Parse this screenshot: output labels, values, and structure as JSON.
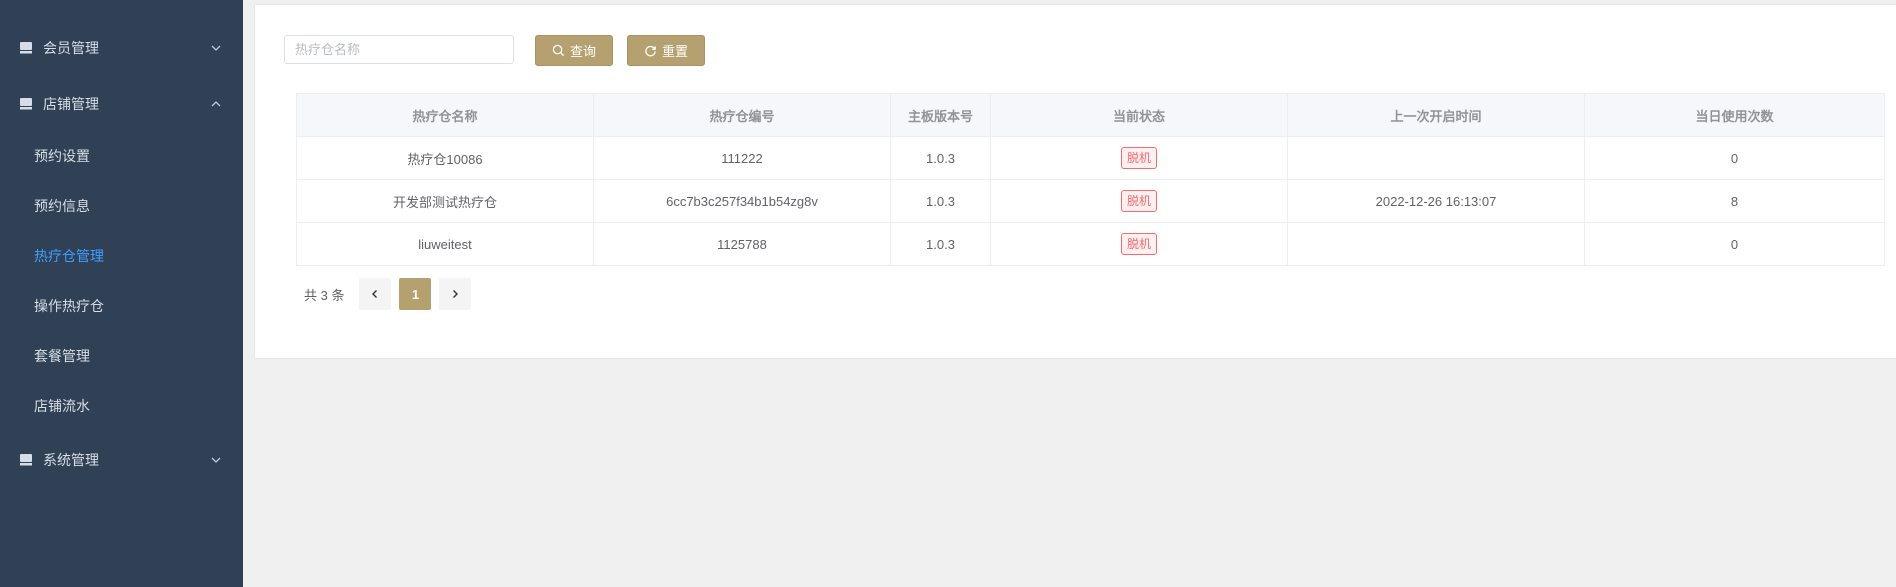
{
  "sidebar": {
    "groups": [
      {
        "label": "会员管理",
        "expanded": false
      },
      {
        "label": "店铺管理",
        "expanded": true
      },
      {
        "label": "系统管理",
        "expanded": false
      }
    ],
    "submenu": [
      {
        "label": "预约设置",
        "active": false
      },
      {
        "label": "预约信息",
        "active": false
      },
      {
        "label": "热疗仓管理",
        "active": true
      },
      {
        "label": "操作热疗仓",
        "active": false
      },
      {
        "label": "套餐管理",
        "active": false
      },
      {
        "label": "店铺流水",
        "active": false
      }
    ],
    "icon": "shop-icon"
  },
  "search": {
    "placeholder": "热疗仓名称",
    "value": "",
    "search_label": "查询",
    "reset_label": "重置"
  },
  "table": {
    "columns": [
      "热疗仓名称",
      "热疗仓编号",
      "主板版本号",
      "当前状态",
      "上一次开启时间",
      "当日使用次数"
    ],
    "rows": [
      {
        "name": "热疗仓10086",
        "code": "111222",
        "version": "1.0.3",
        "status": "脱机",
        "last_open": "",
        "uses_today": "0"
      },
      {
        "name": "开发部测试热疗仓",
        "code": "6cc7b3c257f34b1b54zg8v",
        "version": "1.0.3",
        "status": "脱机",
        "last_open": "2022-12-26 16:13:07",
        "uses_today": "8"
      },
      {
        "name": "liuweitest",
        "code": "1125788",
        "version": "1.0.3",
        "status": "脱机",
        "last_open": "",
        "uses_today": "0"
      }
    ]
  },
  "pagination": {
    "total_text": "共 3 条",
    "current_page": "1"
  },
  "colors": {
    "sidebar_bg": "#304156",
    "accent": "#b5a070",
    "active_menu": "#409eff",
    "status_offline": "#f56c6c"
  }
}
